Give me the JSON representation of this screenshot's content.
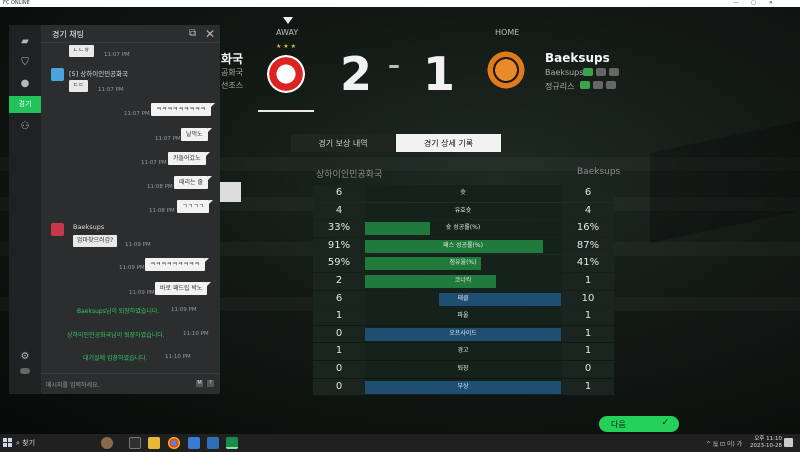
{
  "window": {
    "title": "FC ONLINE",
    "min": "—",
    "max": "▢",
    "close": "✕"
  },
  "match": {
    "away_label": "AWAY",
    "home_label": "HOME",
    "away_name_partial": "화국",
    "away_sub1_partial": "공화국",
    "away_sub2_partial": "선조스",
    "away_score": "2",
    "dash": "–",
    "home_score": "1",
    "home_name": "Baeksups",
    "home_sub1": "Baeksups",
    "home_sub2": "정규리스",
    "away_stars": "★ ★ ★"
  },
  "tabs": [
    {
      "label": "경기 보상 내역",
      "active": false
    },
    {
      "label": "경기 상세 기록",
      "active": true
    }
  ],
  "stats_header": {
    "left_team": "상하이인민공화국",
    "right_team": "Baeksups"
  },
  "stats": [
    {
      "label": "슛",
      "left": "6",
      "right": "6",
      "bar": "none"
    },
    {
      "label": "유효슛",
      "left": "4",
      "right": "4",
      "bar": "none"
    },
    {
      "label": "슛 성공률(%)",
      "left": "33%",
      "right": "16%",
      "bar": "left",
      "fraction": 0.33
    },
    {
      "label": "패스 성공률(%)",
      "left": "91%",
      "right": "87%",
      "bar": "left",
      "fraction": 0.91
    },
    {
      "label": "점유율(%)",
      "left": "59%",
      "right": "41%",
      "bar": "left",
      "fraction": 0.59
    },
    {
      "label": "코너킥",
      "left": "2",
      "right": "1",
      "bar": "left",
      "fraction": 0.67
    },
    {
      "label": "태클",
      "left": "6",
      "right": "10",
      "bar": "right",
      "fraction": 0.62
    },
    {
      "label": "파울",
      "left": "1",
      "right": "1",
      "bar": "none"
    },
    {
      "label": "오프사이드",
      "left": "0",
      "right": "1",
      "bar": "right",
      "fraction": 1.0
    },
    {
      "label": "경고",
      "left": "1",
      "right": "1",
      "bar": "none"
    },
    {
      "label": "퇴장",
      "left": "0",
      "right": "0",
      "bar": "none"
    },
    {
      "label": "부상",
      "left": "0",
      "right": "1",
      "bar": "right",
      "fraction": 1.0
    }
  ],
  "next_button": "다음",
  "chat": {
    "title": "경기 채팅",
    "sidebar_active": "경기",
    "input_placeholder": "메시지를 입력하세요.",
    "messages": [
      {
        "type": "theirs_top",
        "text": "ㄴㄴㅎ",
        "time": "11:07 PM"
      },
      {
        "type": "nick",
        "text": "[5] 상하이인민공화국"
      },
      {
        "type": "theirs_top",
        "text": "ㄷㄷ",
        "time": "11:07 PM"
      },
      {
        "type": "mine",
        "text": "ㅋㅋㅋㅋㅋㅋㅋㅋㅋ",
        "time": "11:07 PM"
      },
      {
        "type": "mine",
        "text": "날먹노",
        "time": "11:07 PM"
      },
      {
        "type": "mine",
        "text": "카들어갔노",
        "time": "11:07 PM"
      },
      {
        "type": "mine",
        "text": "때리는 줄",
        "time": "11:08 PM"
      },
      {
        "type": "mine",
        "text": "ㄱㄱㄱㄱ",
        "time": "11:08 PM"
      },
      {
        "type": "nick",
        "text": "Baeksups"
      },
      {
        "type": "theirs",
        "text": "엄마찾으러감?",
        "time": "11:09 PM"
      },
      {
        "type": "mine",
        "text": "ㅋㅋㅋㅋㅋㅋㅋㅋㅋ",
        "time": "11:09 PM"
      },
      {
        "type": "mine",
        "text": "바로 패드립 박노",
        "time": "11:09 PM"
      },
      {
        "type": "sys",
        "text": "Baeksups님이 퇴장하였습니다.",
        "time": "11:09 PM"
      },
      {
        "type": "sys",
        "text": "상하이인민공화국님이 퇴장하였습니다.",
        "time": "11:10 PM"
      },
      {
        "type": "sys",
        "text": "대기실에 입장하였습니다.",
        "time": "11:10 PM"
      }
    ]
  },
  "taskbar": {
    "search": "찾기",
    "tray": "^ 🖫 ⊡ 이) 가",
    "time": "오후 11:10",
    "date": "2023-10-28"
  }
}
